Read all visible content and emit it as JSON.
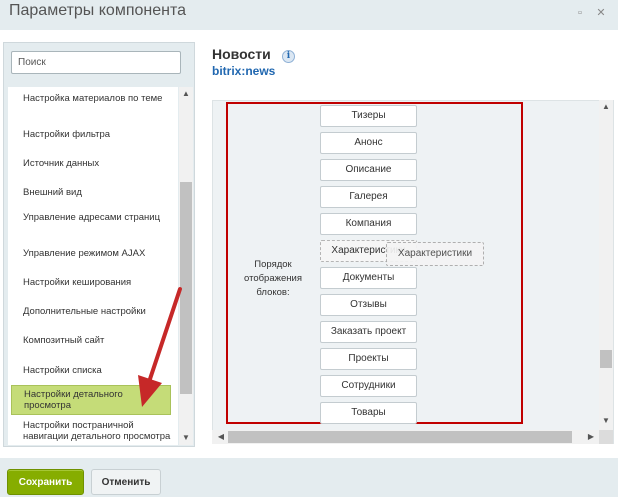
{
  "window": {
    "title": "Параметры компонента",
    "minimize_glyph": "▫",
    "close_glyph": "✕"
  },
  "sidebar": {
    "search_placeholder": "Поиск",
    "items": [
      {
        "label": "Настройка материалов по теме",
        "active": false
      },
      {
        "label": "Настройки фильтра",
        "active": false
      },
      {
        "label": "Источник данных",
        "active": false
      },
      {
        "label": "Внешний вид",
        "active": false
      },
      {
        "label": "Управление адресами страниц",
        "active": false
      },
      {
        "label": "Управление режимом AJAX",
        "active": false
      },
      {
        "label": "Настройки кеширования",
        "active": false
      },
      {
        "label": "Дополнительные настройки",
        "active": false
      },
      {
        "label": "Композитный сайт",
        "active": false
      },
      {
        "label": "Настройки списка",
        "active": false
      },
      {
        "label": "Настройки детального просмотра",
        "active": true
      },
      {
        "label": "Настройки постраничной навигации детального просмотра",
        "active": false
      }
    ]
  },
  "component": {
    "name": "Новости",
    "code": "bitrix:news",
    "info_glyph": "i"
  },
  "block_order": {
    "label": "Порядок отображения блоков:",
    "blocks": [
      "Тизеры",
      "Анонс",
      "Описание",
      "Галерея",
      "Компания",
      "Характеристики",
      "Документы",
      "Отзывы",
      "Заказать проект",
      "Проекты",
      "Сотрудники",
      "Товары"
    ],
    "dragging_label": "Характеристики",
    "highlight_color": "#c00000"
  },
  "footer": {
    "save_label": "Сохранить",
    "cancel_label": "Отменить",
    "save_color": "#86ad00"
  }
}
